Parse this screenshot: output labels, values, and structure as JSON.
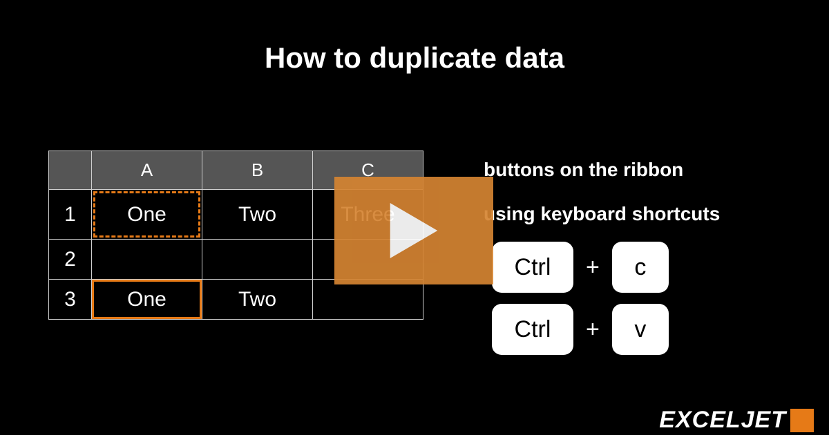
{
  "title": "How to duplicate data",
  "sheet": {
    "columns": [
      "A",
      "B",
      "C"
    ],
    "rows": [
      "1",
      "2",
      "3"
    ],
    "cells": {
      "r1": {
        "a": "One",
        "b": "Two",
        "c": "Three"
      },
      "r2": {
        "a": "",
        "b": "",
        "c": ""
      },
      "r3": {
        "a": "One",
        "b": "Two",
        "c": ""
      }
    }
  },
  "side": {
    "line1": "buttons on the ribbon",
    "line2": "using keyboard shortcuts"
  },
  "shortcuts": {
    "copy": {
      "mod": "Ctrl",
      "plus": "+",
      "key": "c"
    },
    "paste": {
      "mod": "Ctrl",
      "plus": "+",
      "key": "v"
    }
  },
  "logo": "EXCELJET"
}
